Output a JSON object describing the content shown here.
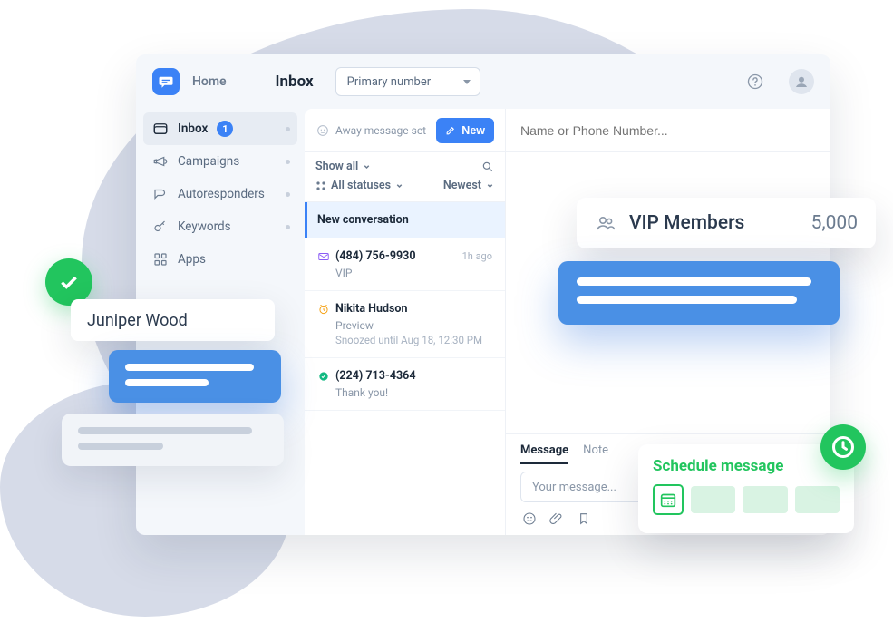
{
  "header": {
    "home_label": "Home",
    "title": "Inbox",
    "number_selector": "Primary number"
  },
  "sidebar": {
    "items": [
      {
        "label": "Inbox",
        "badge": "1"
      },
      {
        "label": "Campaigns"
      },
      {
        "label": "Autoresponders"
      },
      {
        "label": "Keywords"
      },
      {
        "label": "Apps"
      }
    ]
  },
  "inbox_panel": {
    "away_msg": "Away message set",
    "new_button": "New",
    "filters": {
      "show": "Show all",
      "status": "All statuses",
      "sort": "Newest"
    },
    "conversations": [
      {
        "title": "New conversation"
      },
      {
        "name": "(484) 756-9930",
        "line2": "VIP",
        "time": "1h ago"
      },
      {
        "name": "Nikita Hudson",
        "line2": "Preview",
        "line3": "Snoozed until Aug 18, 12:30 PM"
      },
      {
        "name": "(224) 713-4364",
        "line2": "Thank you!"
      }
    ]
  },
  "conversation": {
    "search_placeholder": "Name or Phone Number...",
    "tabs": {
      "message": "Message",
      "note": "Note"
    },
    "input_placeholder": "Your message..."
  },
  "overlays": {
    "juniper": "Juniper Wood",
    "vip_title": "VIP Members",
    "vip_count": "5,000",
    "schedule_title": "Schedule message"
  }
}
